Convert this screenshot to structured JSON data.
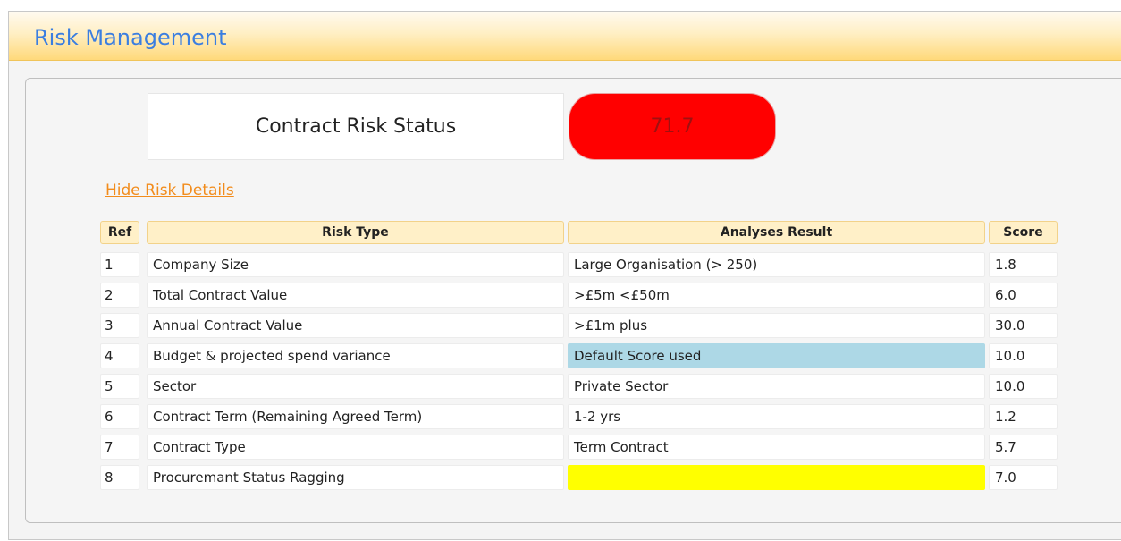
{
  "header": {
    "title": "Risk Management"
  },
  "status": {
    "label": "Contract Risk Status",
    "score": "71.7",
    "score_color": "#ff0000"
  },
  "hide_details_link": "Hide Risk Details",
  "table": {
    "columns": [
      "Ref",
      "Risk Type",
      "Analyses Result",
      "Score"
    ],
    "rows": [
      {
        "ref": "1",
        "risk_type": "Company Size",
        "result": "Large Organisation (> 250)",
        "score": "1.8",
        "highlight": ""
      },
      {
        "ref": "2",
        "risk_type": "Total Contract Value",
        "result": ">£5m <£50m",
        "score": "6.0",
        "highlight": ""
      },
      {
        "ref": "3",
        "risk_type": "Annual Contract Value",
        "result": ">£1m plus",
        "score": "30.0",
        "highlight": ""
      },
      {
        "ref": "4",
        "risk_type": "Budget & projected spend variance",
        "result": "Default Score used",
        "score": "10.0",
        "highlight": "#add8e6"
      },
      {
        "ref": "5",
        "risk_type": "Sector",
        "result": "Private Sector",
        "score": "10.0",
        "highlight": ""
      },
      {
        "ref": "6",
        "risk_type": "Contract Term (Remaining Agreed Term)",
        "result": "1-2 yrs",
        "score": "1.2",
        "highlight": ""
      },
      {
        "ref": "7",
        "risk_type": "Contract Type",
        "result": "Term Contract",
        "score": "5.7",
        "highlight": ""
      },
      {
        "ref": "8",
        "risk_type": "Procuremant Status Ragging",
        "result": "",
        "score": "7.0",
        "highlight": "#ffff00"
      }
    ]
  }
}
